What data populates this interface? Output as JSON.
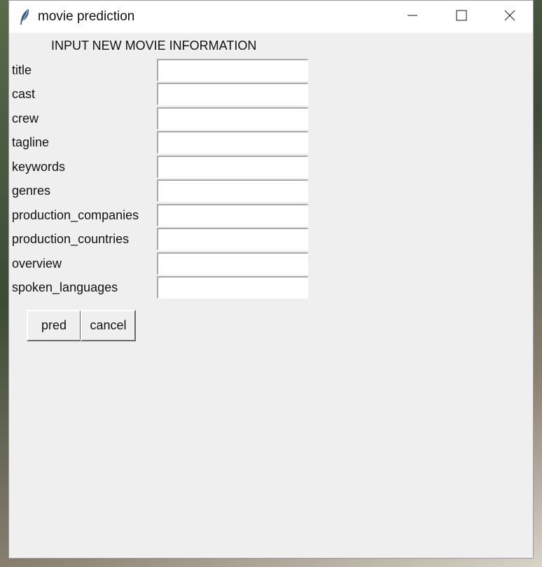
{
  "window": {
    "title": "movie prediction",
    "icon": "feather-icon",
    "controls": [
      "minimize-icon",
      "maximize-icon",
      "close-icon"
    ]
  },
  "form": {
    "heading": "INPUT NEW MOVIE INFORMATION",
    "fields": [
      {
        "label": "title",
        "value": ""
      },
      {
        "label": "cast",
        "value": ""
      },
      {
        "label": "crew",
        "value": ""
      },
      {
        "label": "tagline",
        "value": ""
      },
      {
        "label": "keywords",
        "value": ""
      },
      {
        "label": "genres",
        "value": ""
      },
      {
        "label": "production_companies",
        "value": ""
      },
      {
        "label": "production_countries",
        "value": ""
      },
      {
        "label": "overview",
        "value": ""
      },
      {
        "label": "spoken_languages",
        "value": ""
      }
    ]
  },
  "buttons": {
    "pred": "pred",
    "cancel": "cancel"
  }
}
